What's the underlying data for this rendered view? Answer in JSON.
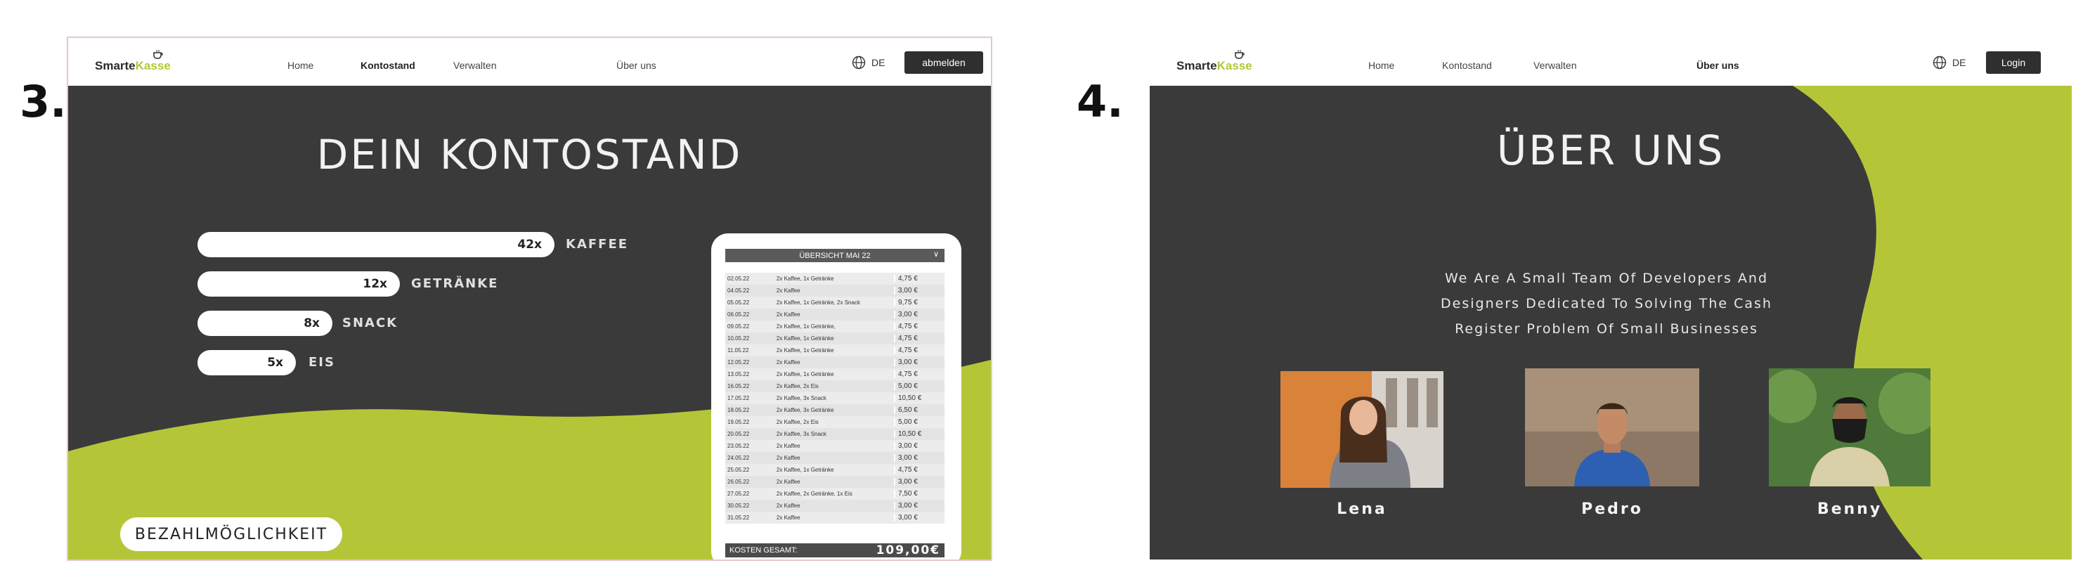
{
  "colors": {
    "dark": "#3a3a3a",
    "accent": "#b4c638",
    "white": "#ffffff"
  },
  "steps": [
    "3.",
    "4."
  ],
  "nav": {
    "logo": {
      "main": "Smarte",
      "accent": "Kasse"
    },
    "links": [
      "Home",
      "Kontostand",
      "Verwalten",
      "Über uns"
    ],
    "lang": "DE",
    "logout": "abmelden",
    "login": "Login"
  },
  "screen3": {
    "title": "DEIN KONTOSTAND",
    "counters": [
      {
        "count": "42x",
        "label": "KAFFEE",
        "value": 42
      },
      {
        "count": "12x",
        "label": "GETRÄNKE",
        "value": 12
      },
      {
        "count": "8x",
        "label": "SNACK",
        "value": 8
      },
      {
        "count": "5x",
        "label": "EIS",
        "value": 5
      }
    ],
    "pay_button": "BEZAHLMÖGLICHKEIT",
    "overview": {
      "header": "ÜBERSICHT MAI 22",
      "rows": [
        [
          "02.05.22",
          "2x Kaffee, 1x Getränke",
          "4,75 €"
        ],
        [
          "04.05.22",
          "2x Kaffee",
          "3,00 €"
        ],
        [
          "05.05.22",
          "2x Kaffee, 1x Getränke, 2x Snack",
          "9,75 €"
        ],
        [
          "06.05.22",
          "2x Kaffee",
          "3,00 €"
        ],
        [
          "09.05.22",
          "2x Kaffee, 1x Getränke,",
          "4,75 €"
        ],
        [
          "10.05.22",
          "2x Kaffee, 1x Getränke",
          "4,75 €"
        ],
        [
          "11.05.22",
          "2x Kaffee, 1x Getränke",
          "4,75 €"
        ],
        [
          "12.05.22",
          "2x Kaffee",
          "3,00 €"
        ],
        [
          "13.05.22",
          "2x Kaffee, 1x Getränke",
          "4,75 €"
        ],
        [
          "16.05.22",
          "2x Kaffee, 2x Eis",
          "5,00 €"
        ],
        [
          "17.05.22",
          "2x Kaffee, 3x Snack",
          "10,50 €"
        ],
        [
          "18.05.22",
          "2x Kaffee, 3x Getränke",
          "6,50 €"
        ],
        [
          "19.05.22",
          "2x Kaffee, 2x Eis",
          "5,00 €"
        ],
        [
          "20.05.22",
          "2x Kaffee, 3x Snack",
          "10,50 €"
        ],
        [
          "23.05.22",
          "2x Kaffee",
          "3,00 €"
        ],
        [
          "24.05.22",
          "2x Kaffee",
          "3,00 €"
        ],
        [
          "25.05.22",
          "2x Kaffee, 1x Getränke",
          "4,75 €"
        ],
        [
          "26.05.22",
          "2x Kaffee",
          "3,00 €"
        ],
        [
          "27.05.22",
          "2x Kaffee, 2x Getränke, 1x Eis",
          "7,50 €"
        ],
        [
          "30.05.22",
          "2x Kaffee",
          "3,00 €"
        ],
        [
          "31.05.22",
          "2x Kaffee",
          "3,00 €"
        ]
      ],
      "total_label": "KOSTEN GESAMT:",
      "total_value": "109,00€"
    }
  },
  "screen4": {
    "title": "ÜBER UNS",
    "text": [
      "We Are A Small Team Of Developers And",
      "Designers Dedicated To Solving The Cash",
      "Register Problem Of Small Businesses"
    ],
    "team": [
      {
        "name": "Lena",
        "photo": "portrait-photo"
      },
      {
        "name": "Pedro",
        "photo": "portrait-photo"
      },
      {
        "name": "Benny",
        "photo": "portrait-photo"
      }
    ]
  }
}
